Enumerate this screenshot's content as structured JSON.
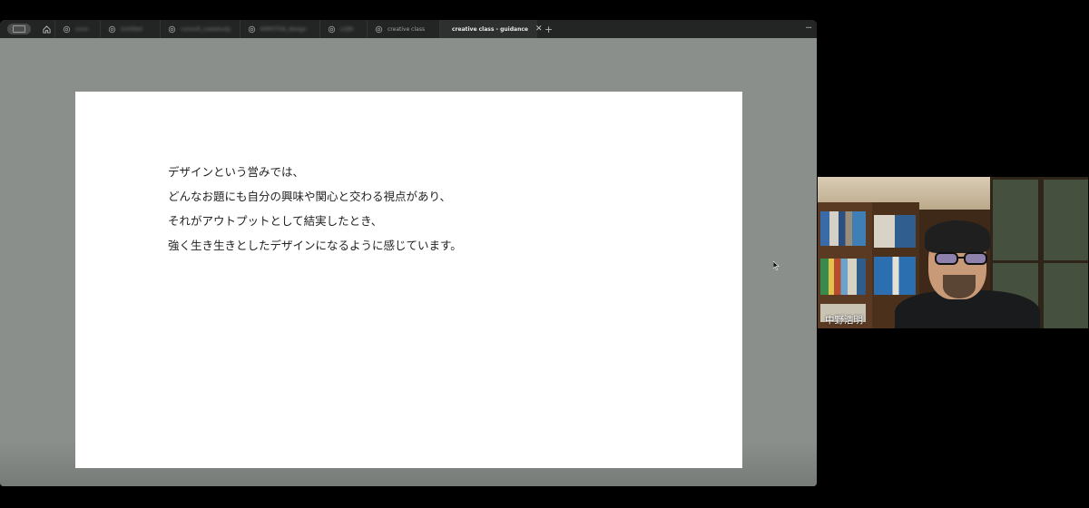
{
  "browser": {
    "tabs": [
      {
        "label": "xxxx",
        "blurred": true,
        "icon": "link-icon"
      },
      {
        "label": "Untitled",
        "blurred": true,
        "icon": "link-icon"
      },
      {
        "label": "consult_casestudy",
        "blurred": true,
        "icon": "link-icon"
      },
      {
        "label": "KIMOTOA_design",
        "blurred": true,
        "icon": "link-icon"
      },
      {
        "label": "LOJN",
        "blurred": true,
        "icon": "link-icon"
      },
      {
        "label": "creative class",
        "blurred": false,
        "icon": "link-icon"
      },
      {
        "label": "creative class - guidance",
        "blurred": false,
        "icon": "play-icon",
        "active": true
      }
    ],
    "close_glyph": "✕",
    "new_tab_glyph": "+",
    "more_glyph": "···"
  },
  "slide": {
    "lines": [
      "デザインという営みでは、",
      "どんなお題にも自分の興味や関心と交わる視点があり、",
      "それがアウトプットとして結実したとき、",
      "強く生き生きとしたデザインになるように感じています。"
    ]
  },
  "video": {
    "participant_name": "中野浩明"
  },
  "colors": {
    "tabbar": "#232524",
    "stage": "#8b8f8c",
    "slide": "#ffffff",
    "active_tab_icon": "#6b8fd6"
  }
}
